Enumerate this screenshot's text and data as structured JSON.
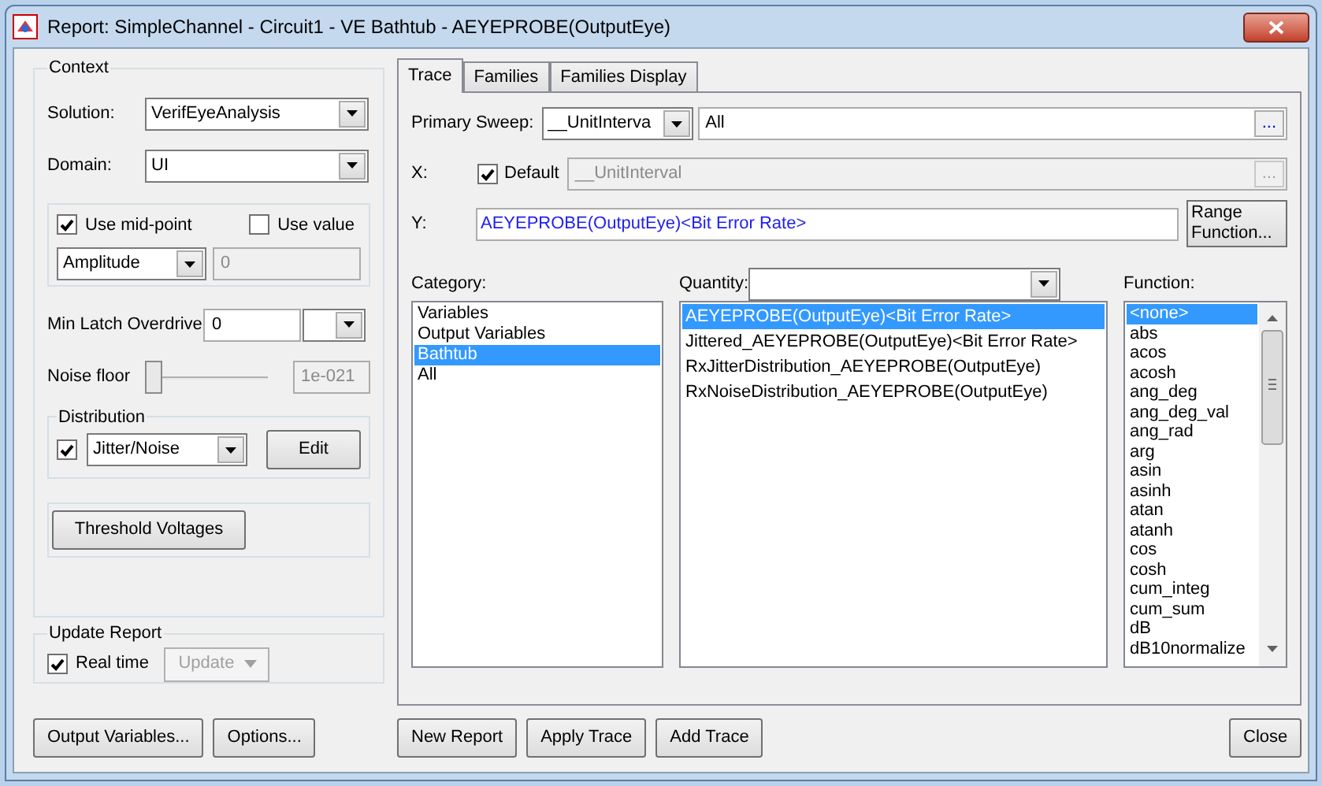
{
  "window": {
    "title": "Report: SimpleChannel - Circuit1 - VE Bathtub - AEYEPROBE(OutputEye)"
  },
  "context": {
    "legend": "Context",
    "solution": {
      "label": "Solution:",
      "value": "VerifEyeAnalysis"
    },
    "domain": {
      "label": "Domain:",
      "value": "UI"
    },
    "mid_point": {
      "label": "Use mid-point",
      "checked": true
    },
    "use_value": {
      "label": "Use value",
      "checked": false
    },
    "mode": {
      "value": "Amplitude"
    },
    "value_field": {
      "value": "0",
      "disabled": true
    },
    "min_latch": {
      "label": "Min Latch Overdrive",
      "value": "0"
    },
    "noise_floor": {
      "label": "Noise floor",
      "level": 0,
      "value": "1e-021"
    },
    "distribution": {
      "legend": "Distribution",
      "checked": true,
      "value": "Jitter/Noise",
      "edit": "Edit"
    },
    "threshold": "Threshold Voltages"
  },
  "update_report": {
    "legend": "Update Report",
    "real_time": {
      "label": "Real time",
      "checked": true
    },
    "update": {
      "label": "Update",
      "disabled": true
    }
  },
  "left_buttons": [
    "Output Variables...",
    "Options..."
  ],
  "tabs": [
    {
      "label": "Trace",
      "selected": true
    },
    {
      "label": "Families",
      "selected": false
    },
    {
      "label": "Families Display",
      "selected": false
    }
  ],
  "primary_sweep": {
    "label": "Primary Sweep:",
    "variable": "__UnitInterva",
    "value": "All",
    "browse": "..."
  },
  "x": {
    "label": "X:",
    "default_checked": true,
    "default_label": "Default",
    "value": "__UnitInterval",
    "browse": "..."
  },
  "y": {
    "label": "Y:",
    "value": "AEYEPROBE(OutputEye)<Bit Error Rate>",
    "range_button": "Range Function..."
  },
  "category": {
    "label": "Category:",
    "items": [
      {
        "label": "Variables",
        "selected": false
      },
      {
        "label": "Output Variables",
        "selected": false
      },
      {
        "label": "Bathtub",
        "selected": true
      },
      {
        "label": "All",
        "selected": false
      }
    ]
  },
  "quantity": {
    "label": "Quantity:",
    "items": [
      {
        "label": "AEYEPROBE(OutputEye)<Bit Error Rate>",
        "selected": true
      },
      {
        "label": "Jittered_AEYEPROBE(OutputEye)<Bit Error Rate>",
        "selected": false
      },
      {
        "label": "RxJitterDistribution_AEYEPROBE(OutputEye)",
        "selected": false
      },
      {
        "label": "RxNoiseDistribution_AEYEPROBE(OutputEye)",
        "selected": false
      }
    ]
  },
  "function": {
    "label": "Function:",
    "items": [
      {
        "label": "<none>",
        "selected": true
      },
      {
        "label": "abs",
        "selected": false
      },
      {
        "label": "acos",
        "selected": false
      },
      {
        "label": "acosh",
        "selected": false
      },
      {
        "label": "ang_deg",
        "selected": false
      },
      {
        "label": "ang_deg_val",
        "selected": false
      },
      {
        "label": "ang_rad",
        "selected": false
      },
      {
        "label": "arg",
        "selected": false
      },
      {
        "label": "asin",
        "selected": false
      },
      {
        "label": "asinh",
        "selected": false
      },
      {
        "label": "atan",
        "selected": false
      },
      {
        "label": "atanh",
        "selected": false
      },
      {
        "label": "cos",
        "selected": false
      },
      {
        "label": "cosh",
        "selected": false
      },
      {
        "label": "cum_integ",
        "selected": false
      },
      {
        "label": "cum_sum",
        "selected": false
      },
      {
        "label": "dB",
        "selected": false
      },
      {
        "label": "dB10normalize",
        "selected": false
      }
    ]
  },
  "bottom_buttons": [
    "New Report",
    "Apply Trace",
    "Add Trace"
  ],
  "close_button": "Close"
}
